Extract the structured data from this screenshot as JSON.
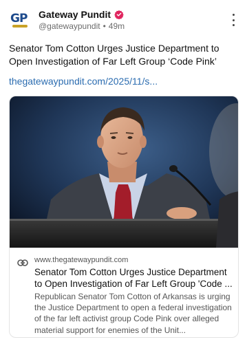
{
  "post": {
    "account_name": "Gateway Pundit",
    "handle": "@gatewaypundit",
    "separator": "•",
    "time_ago": "49m",
    "avatar_text": "GP",
    "text": "Senator Tom Cotton Urges Justice Department to Open Investigation of Far Left Group ‘Code Pink’",
    "link_text": "thegatewaypundit.com/2025/11/s..."
  },
  "card": {
    "domain": "www.thegatewaypundit.com",
    "title": "Senator Tom Cotton Urges Justice Department to Open Investigation of Far Left Group 'Code ...",
    "description": "        Republican Senator Tom Cotton of Arkansas is urging the Justice Department to open a federal investigation of the far left activist group Code Pink over alleged material support for enemies of the Unit..."
  },
  "icons": {
    "verified": "verified-badge-icon",
    "more": "more-vertical-icon",
    "link": "link-icon"
  },
  "colors": {
    "link": "#2b6cb0",
    "verified": "#e0245e",
    "avatar_text": "#1d4a8c",
    "avatar_accent": "#c9a227"
  }
}
